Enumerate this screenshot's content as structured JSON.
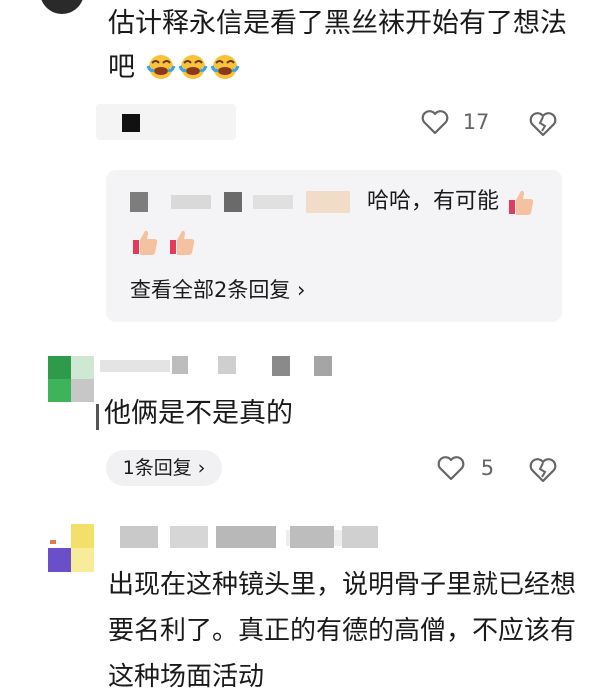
{
  "comment1": {
    "text": "估计释永信是看了黑丝袜开始有了想法吧",
    "emojis": [
      "laugh-cry-emoji",
      "laugh-cry-emoji",
      "laugh-cry-emoji"
    ],
    "likes": "17"
  },
  "replies": {
    "preview_text": "哈哈，有可能",
    "thumbs": [
      "thumbs-up-emoji",
      "thumbs-up-emoji",
      "thumbs-up-emoji"
    ],
    "view_all": "查看全部2条回复 ›"
  },
  "comment2": {
    "text": "他俩是不是真的",
    "replies_label": "1条回复 ›",
    "likes": "5"
  },
  "comment3": {
    "text": "出现在这种镜头里，说明骨子里就已经想要名利了。真正的有德的高僧，不应该有这种场面活动"
  },
  "colors": {
    "background": "#ffffff",
    "reply_box": "#f4f4f6",
    "icon_gray": "#666666"
  }
}
